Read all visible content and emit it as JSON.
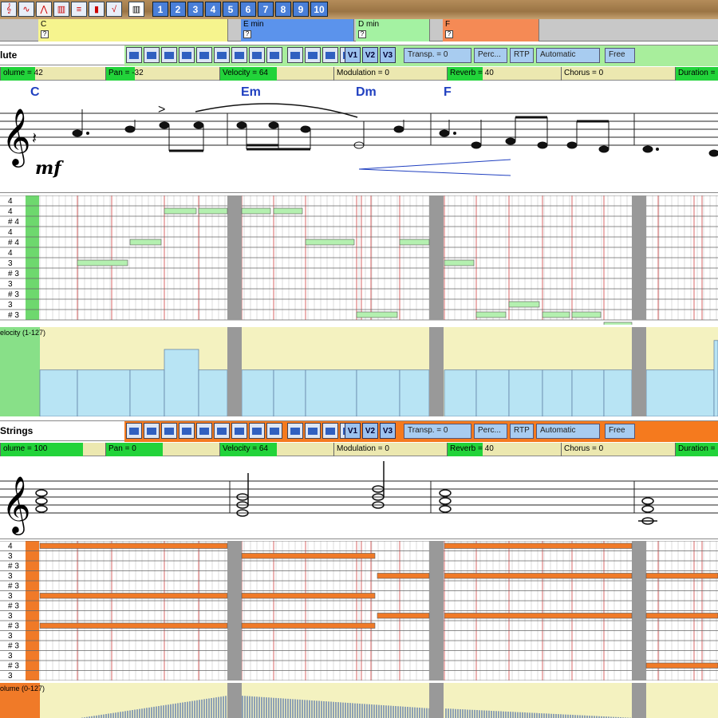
{
  "toolbar": {
    "icons": [
      "score-view-icon",
      "wave-icon",
      "edit-icon",
      "arrange-icon",
      "mixer-icon",
      "bars-icon",
      "curve-icon",
      "keyboard-icon"
    ],
    "numbers": [
      "1",
      "2",
      "3",
      "4",
      "5",
      "6",
      "7",
      "8",
      "9",
      "10"
    ]
  },
  "chords": [
    {
      "name": "C",
      "color": "#f6f48e"
    },
    {
      "name": "E min",
      "color": "#5b93ec"
    },
    {
      "name": "D min",
      "color": "#a4f2a2"
    },
    {
      "name": "F",
      "color": "#f58a55"
    }
  ],
  "chord_q": "?",
  "tracks": [
    {
      "name": "lute",
      "head_color": "#a8ee9c",
      "params": [
        {
          "label": "olume = 42",
          "fill": 0.33
        },
        {
          "label": "Pan = -32",
          "fill": 0.25
        },
        {
          "label": "Velocity = 64",
          "fill": 0.5
        },
        {
          "label": "Modulation = 0",
          "fill": 0
        },
        {
          "label": "Reverb = 40",
          "fill": 0.31
        },
        {
          "label": "Chorus = 0",
          "fill": 0
        },
        {
          "label": "Duration =",
          "fill": 1
        }
      ],
      "score_chords": [
        "C",
        "Em",
        "Dm",
        "F"
      ],
      "dynamic": "mf",
      "pitch_labels": [
        "4",
        "4",
        "# 4",
        "4",
        "# 4",
        "4",
        "3",
        "# 3",
        "3",
        "# 3",
        "3",
        "# 3"
      ],
      "notes": [
        [
          97,
          160,
          6
        ],
        [
          163,
          202,
          4
        ],
        [
          206,
          246,
          1
        ],
        [
          249,
          285,
          1
        ],
        [
          303,
          339,
          1
        ],
        [
          343,
          379,
          1
        ],
        [
          383,
          444,
          4
        ],
        [
          501,
          538,
          4
        ],
        [
          447,
          498,
          11
        ],
        [
          557,
          594,
          6
        ],
        [
          597,
          634,
          11
        ],
        [
          638,
          676,
          10
        ],
        [
          680,
          714,
          11
        ],
        [
          717,
          753,
          11
        ],
        [
          757,
          792,
          12
        ]
      ],
      "vel_label": "elocity (1-127)",
      "vel_bars": [
        [
          50,
          97,
          0.52
        ],
        [
          97,
          163,
          0.52
        ],
        [
          163,
          206,
          0.52
        ],
        [
          206,
          249,
          0.75
        ],
        [
          249,
          285,
          0.52
        ],
        [
          303,
          343,
          0.52
        ],
        [
          343,
          383,
          0.52
        ],
        [
          383,
          447,
          0.52
        ],
        [
          447,
          501,
          0.52
        ],
        [
          501,
          538,
          0.52
        ],
        [
          557,
          597,
          0.52
        ],
        [
          597,
          638,
          0.52
        ],
        [
          638,
          680,
          0.52
        ],
        [
          680,
          717,
          0.52
        ],
        [
          717,
          757,
          0.52
        ],
        [
          757,
          792,
          0.52
        ],
        [
          810,
          895,
          0.52
        ],
        [
          895,
          900,
          0.85
        ]
      ]
    },
    {
      "name": "Strings",
      "head_color": "#f57a1e",
      "params": [
        {
          "label": "olume = 100",
          "fill": 0.79
        },
        {
          "label": "Pan = 0",
          "fill": 0.5
        },
        {
          "label": "Velocity = 64",
          "fill": 0.5
        },
        {
          "label": "Modulation = 0",
          "fill": 0
        },
        {
          "label": "Reverb = 40",
          "fill": 0.31
        },
        {
          "label": "Chorus = 0",
          "fill": 0
        },
        {
          "label": "Duration =",
          "fill": 1
        }
      ],
      "pitch_labels": [
        "4",
        "3",
        "# 3",
        "3",
        "# 3",
        "3",
        "# 3",
        "3",
        "# 3",
        "3",
        "# 3",
        "3",
        "# 3",
        "3"
      ],
      "notes": [
        [
          50,
          285,
          0
        ],
        [
          303,
          470,
          1
        ],
        [
          473,
          538,
          3
        ],
        [
          557,
          792,
          0
        ],
        [
          557,
          792,
          3
        ],
        [
          810,
          900,
          3
        ],
        [
          50,
          285,
          5
        ],
        [
          303,
          470,
          5
        ],
        [
          473,
          538,
          7
        ],
        [
          557,
          792,
          7
        ],
        [
          810,
          900,
          7
        ],
        [
          50,
          285,
          8
        ],
        [
          303,
          470,
          8
        ],
        [
          810,
          900,
          12
        ]
      ],
      "vol_label": "olume (0-127)"
    }
  ],
  "mode_labels": {
    "transp": "Transp. = 0",
    "perc": "Perc...",
    "rtp": "RTP",
    "auto": "Automatic",
    "free": "Free"
  },
  "voice_labels": [
    "V1",
    "V2",
    "V3"
  ]
}
